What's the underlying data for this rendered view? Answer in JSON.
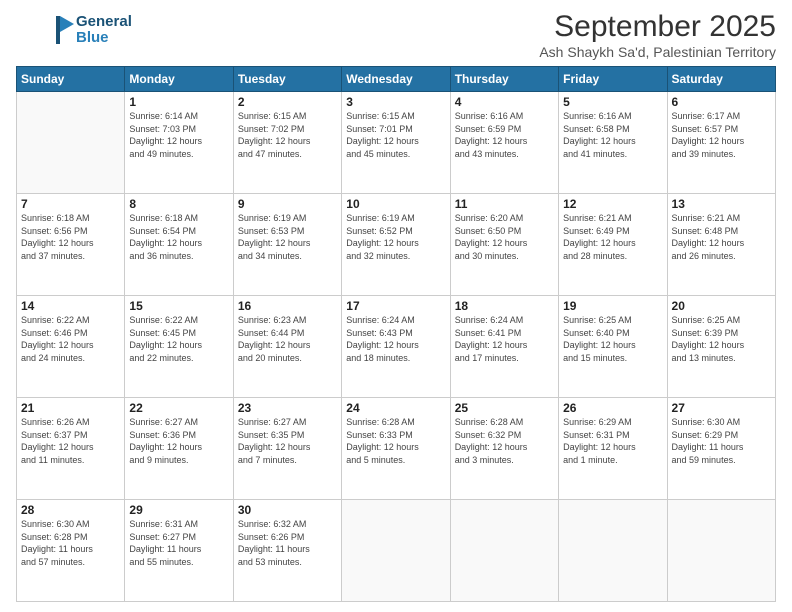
{
  "header": {
    "logo_line1": "General",
    "logo_line2": "Blue",
    "month_title": "September 2025",
    "location": "Ash Shaykh Sa'd, Palestinian Territory"
  },
  "days_of_week": [
    "Sunday",
    "Monday",
    "Tuesday",
    "Wednesday",
    "Thursday",
    "Friday",
    "Saturday"
  ],
  "weeks": [
    [
      {
        "day": "",
        "info": ""
      },
      {
        "day": "1",
        "info": "Sunrise: 6:14 AM\nSunset: 7:03 PM\nDaylight: 12 hours\nand 49 minutes."
      },
      {
        "day": "2",
        "info": "Sunrise: 6:15 AM\nSunset: 7:02 PM\nDaylight: 12 hours\nand 47 minutes."
      },
      {
        "day": "3",
        "info": "Sunrise: 6:15 AM\nSunset: 7:01 PM\nDaylight: 12 hours\nand 45 minutes."
      },
      {
        "day": "4",
        "info": "Sunrise: 6:16 AM\nSunset: 6:59 PM\nDaylight: 12 hours\nand 43 minutes."
      },
      {
        "day": "5",
        "info": "Sunrise: 6:16 AM\nSunset: 6:58 PM\nDaylight: 12 hours\nand 41 minutes."
      },
      {
        "day": "6",
        "info": "Sunrise: 6:17 AM\nSunset: 6:57 PM\nDaylight: 12 hours\nand 39 minutes."
      }
    ],
    [
      {
        "day": "7",
        "info": "Sunrise: 6:18 AM\nSunset: 6:56 PM\nDaylight: 12 hours\nand 37 minutes."
      },
      {
        "day": "8",
        "info": "Sunrise: 6:18 AM\nSunset: 6:54 PM\nDaylight: 12 hours\nand 36 minutes."
      },
      {
        "day": "9",
        "info": "Sunrise: 6:19 AM\nSunset: 6:53 PM\nDaylight: 12 hours\nand 34 minutes."
      },
      {
        "day": "10",
        "info": "Sunrise: 6:19 AM\nSunset: 6:52 PM\nDaylight: 12 hours\nand 32 minutes."
      },
      {
        "day": "11",
        "info": "Sunrise: 6:20 AM\nSunset: 6:50 PM\nDaylight: 12 hours\nand 30 minutes."
      },
      {
        "day": "12",
        "info": "Sunrise: 6:21 AM\nSunset: 6:49 PM\nDaylight: 12 hours\nand 28 minutes."
      },
      {
        "day": "13",
        "info": "Sunrise: 6:21 AM\nSunset: 6:48 PM\nDaylight: 12 hours\nand 26 minutes."
      }
    ],
    [
      {
        "day": "14",
        "info": "Sunrise: 6:22 AM\nSunset: 6:46 PM\nDaylight: 12 hours\nand 24 minutes."
      },
      {
        "day": "15",
        "info": "Sunrise: 6:22 AM\nSunset: 6:45 PM\nDaylight: 12 hours\nand 22 minutes."
      },
      {
        "day": "16",
        "info": "Sunrise: 6:23 AM\nSunset: 6:44 PM\nDaylight: 12 hours\nand 20 minutes."
      },
      {
        "day": "17",
        "info": "Sunrise: 6:24 AM\nSunset: 6:43 PM\nDaylight: 12 hours\nand 18 minutes."
      },
      {
        "day": "18",
        "info": "Sunrise: 6:24 AM\nSunset: 6:41 PM\nDaylight: 12 hours\nand 17 minutes."
      },
      {
        "day": "19",
        "info": "Sunrise: 6:25 AM\nSunset: 6:40 PM\nDaylight: 12 hours\nand 15 minutes."
      },
      {
        "day": "20",
        "info": "Sunrise: 6:25 AM\nSunset: 6:39 PM\nDaylight: 12 hours\nand 13 minutes."
      }
    ],
    [
      {
        "day": "21",
        "info": "Sunrise: 6:26 AM\nSunset: 6:37 PM\nDaylight: 12 hours\nand 11 minutes."
      },
      {
        "day": "22",
        "info": "Sunrise: 6:27 AM\nSunset: 6:36 PM\nDaylight: 12 hours\nand 9 minutes."
      },
      {
        "day": "23",
        "info": "Sunrise: 6:27 AM\nSunset: 6:35 PM\nDaylight: 12 hours\nand 7 minutes."
      },
      {
        "day": "24",
        "info": "Sunrise: 6:28 AM\nSunset: 6:33 PM\nDaylight: 12 hours\nand 5 minutes."
      },
      {
        "day": "25",
        "info": "Sunrise: 6:28 AM\nSunset: 6:32 PM\nDaylight: 12 hours\nand 3 minutes."
      },
      {
        "day": "26",
        "info": "Sunrise: 6:29 AM\nSunset: 6:31 PM\nDaylight: 12 hours\nand 1 minute."
      },
      {
        "day": "27",
        "info": "Sunrise: 6:30 AM\nSunset: 6:29 PM\nDaylight: 11 hours\nand 59 minutes."
      }
    ],
    [
      {
        "day": "28",
        "info": "Sunrise: 6:30 AM\nSunset: 6:28 PM\nDaylight: 11 hours\nand 57 minutes."
      },
      {
        "day": "29",
        "info": "Sunrise: 6:31 AM\nSunset: 6:27 PM\nDaylight: 11 hours\nand 55 minutes."
      },
      {
        "day": "30",
        "info": "Sunrise: 6:32 AM\nSunset: 6:26 PM\nDaylight: 11 hours\nand 53 minutes."
      },
      {
        "day": "",
        "info": ""
      },
      {
        "day": "",
        "info": ""
      },
      {
        "day": "",
        "info": ""
      },
      {
        "day": "",
        "info": ""
      }
    ]
  ]
}
